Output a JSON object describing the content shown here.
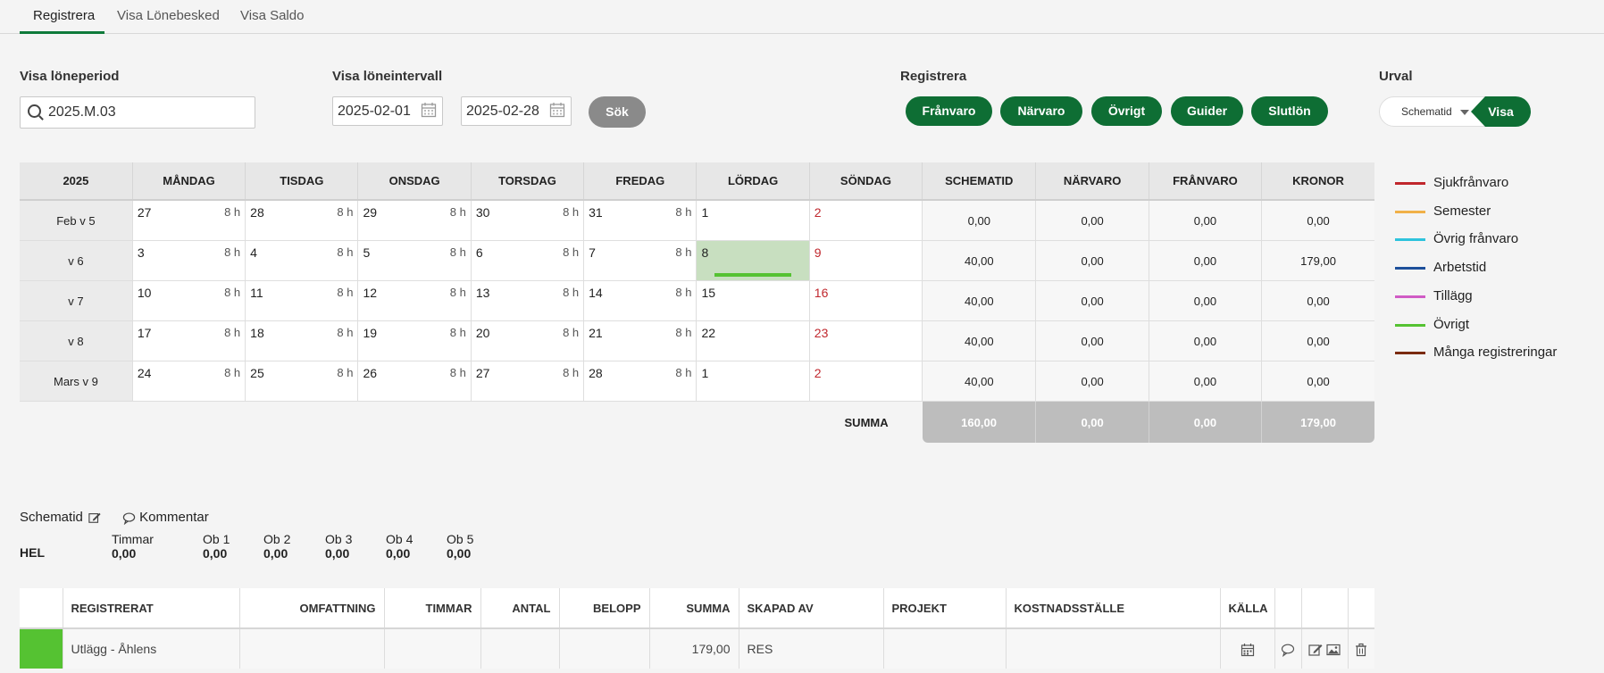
{
  "tabs": [
    "Registrera",
    "Visa Lönebesked",
    "Visa Saldo"
  ],
  "filters": {
    "loneperiod_label": "Visa löneperiod",
    "loneperiod_value": "2025.M.03",
    "loneintervall_label": "Visa löneintervall",
    "date_from": "2025-02-01",
    "date_to": "2025-02-28",
    "search_button": "Sök"
  },
  "registrera": {
    "label": "Registrera",
    "buttons": [
      "Frånvaro",
      "Närvaro",
      "Övrigt",
      "Guider",
      "Slutlön"
    ]
  },
  "urval": {
    "label": "Urval",
    "selected": "Schematid",
    "button": "Visa"
  },
  "calendar": {
    "year": "2025",
    "day_headers": [
      "MÅNDAG",
      "TISDAG",
      "ONSDAG",
      "TORSDAG",
      "FREDAG",
      "LÖRDAG",
      "SÖNDAG"
    ],
    "sum_headers": [
      "SCHEMATID",
      "NÄRVARO",
      "FRÅNVARO",
      "KRONOR"
    ],
    "rows": [
      {
        "week": "Feb v 5",
        "days": [
          {
            "n": "27",
            "h": "8 h"
          },
          {
            "n": "28",
            "h": "8 h"
          },
          {
            "n": "29",
            "h": "8 h"
          },
          {
            "n": "30",
            "h": "8 h"
          },
          {
            "n": "31",
            "h": "8 h"
          },
          {
            "n": "1",
            "h": ""
          },
          {
            "n": "2",
            "h": "",
            "red": true
          }
        ],
        "sums": [
          "0,00",
          "0,00",
          "0,00",
          "0,00"
        ]
      },
      {
        "week": "v 6",
        "days": [
          {
            "n": "3",
            "h": "8 h"
          },
          {
            "n": "4",
            "h": "8 h"
          },
          {
            "n": "5",
            "h": "8 h"
          },
          {
            "n": "6",
            "h": "8 h"
          },
          {
            "n": "7",
            "h": "8 h"
          },
          {
            "n": "8",
            "h": "",
            "highlight": true,
            "bar": "#55c232"
          },
          {
            "n": "9",
            "h": "",
            "red": true
          }
        ],
        "sums": [
          "40,00",
          "0,00",
          "0,00",
          "179,00"
        ]
      },
      {
        "week": "v 7",
        "days": [
          {
            "n": "10",
            "h": "8 h"
          },
          {
            "n": "11",
            "h": "8 h"
          },
          {
            "n": "12",
            "h": "8 h"
          },
          {
            "n": "13",
            "h": "8 h"
          },
          {
            "n": "14",
            "h": "8 h"
          },
          {
            "n": "15",
            "h": ""
          },
          {
            "n": "16",
            "h": "",
            "red": true
          }
        ],
        "sums": [
          "40,00",
          "0,00",
          "0,00",
          "0,00"
        ]
      },
      {
        "week": "v 8",
        "days": [
          {
            "n": "17",
            "h": "8 h"
          },
          {
            "n": "18",
            "h": "8 h"
          },
          {
            "n": "19",
            "h": "8 h"
          },
          {
            "n": "20",
            "h": "8 h"
          },
          {
            "n": "21",
            "h": "8 h"
          },
          {
            "n": "22",
            "h": ""
          },
          {
            "n": "23",
            "h": "",
            "red": true
          }
        ],
        "sums": [
          "40,00",
          "0,00",
          "0,00",
          "0,00"
        ]
      },
      {
        "week": "Mars v 9",
        "days": [
          {
            "n": "24",
            "h": "8 h"
          },
          {
            "n": "25",
            "h": "8 h"
          },
          {
            "n": "26",
            "h": "8 h"
          },
          {
            "n": "27",
            "h": "8 h"
          },
          {
            "n": "28",
            "h": "8 h"
          },
          {
            "n": "1",
            "h": ""
          },
          {
            "n": "2",
            "h": "",
            "red": true
          }
        ],
        "sums": [
          "40,00",
          "0,00",
          "0,00",
          "0,00"
        ]
      }
    ],
    "summa_label": "SUMMA",
    "totals": [
      "160,00",
      "0,00",
      "0,00",
      "179,00"
    ]
  },
  "legend": [
    {
      "label": "Sjukfrånvaro",
      "color": "#c0272d"
    },
    {
      "label": "Semester",
      "color": "#f0b048"
    },
    {
      "label": "Övrig frånvaro",
      "color": "#2ec3dc"
    },
    {
      "label": "Arbetstid",
      "color": "#1d4f9a"
    },
    {
      "label": "Tillägg",
      "color": "#d05bc5"
    },
    {
      "label": "Övrigt",
      "color": "#55c232"
    },
    {
      "label": "Många registreringar",
      "color": "#7a2a10"
    }
  ],
  "schedule_info": {
    "schematid_label": "Schematid",
    "kommentar_label": "Kommentar",
    "type": "HEL",
    "timmar_label": "Timmar",
    "timmar_value": "0,00",
    "ob": [
      {
        "label": "Ob 1",
        "value": "0,00"
      },
      {
        "label": "Ob 2",
        "value": "0,00"
      },
      {
        "label": "Ob 3",
        "value": "0,00"
      },
      {
        "label": "Ob 4",
        "value": "0,00"
      },
      {
        "label": "Ob 5",
        "value": "0,00"
      }
    ]
  },
  "registrations": {
    "headers": [
      "REGISTRERAT",
      "OMFATTNING",
      "TIMMAR",
      "ANTAL",
      "BELOPP",
      "SUMMA",
      "SKAPAD AV",
      "PROJEKT",
      "KOSTNADSSTÄLLE",
      "KÄLLA"
    ],
    "rows": [
      {
        "color": "#55c232",
        "registrerat": "Utlägg - Åhlens",
        "omfattning": "",
        "timmar": "",
        "antal": "",
        "belopp": "",
        "summa": "179,00",
        "skapad_av": "RES",
        "projekt": "",
        "kostnadsstalle": ""
      }
    ]
  }
}
